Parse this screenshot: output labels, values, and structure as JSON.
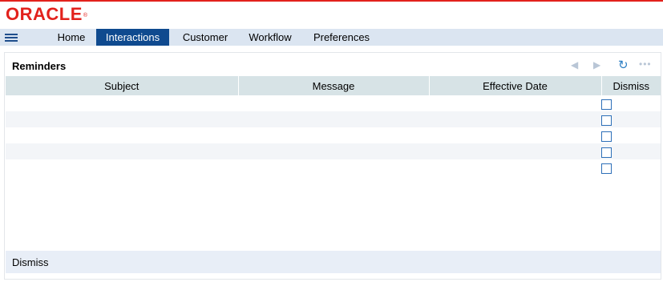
{
  "brand": {
    "logo_text": "ORACLE",
    "registered_mark": "®",
    "accent_color": "#e2211c"
  },
  "nav": {
    "menu_icon": "hamburger-menu-icon",
    "items": [
      {
        "label": "Home",
        "active": false
      },
      {
        "label": "Interactions",
        "active": true
      },
      {
        "label": "Customer",
        "active": false
      },
      {
        "label": "Workflow",
        "active": false
      },
      {
        "label": "Preferences",
        "active": false
      }
    ]
  },
  "reminders": {
    "title": "Reminders",
    "toolbar": {
      "prev_icon": "triangle-left-icon",
      "next_icon": "triangle-right-icon",
      "refresh_icon": "refresh-icon",
      "more_icon": "ellipsis-icon"
    },
    "columns": [
      "Subject",
      "Message",
      "Effective Date",
      "Dismiss"
    ],
    "rows": [
      {
        "subject": "",
        "message": "",
        "effective_date": "",
        "dismiss": false
      },
      {
        "subject": "",
        "message": "",
        "effective_date": "",
        "dismiss": false
      },
      {
        "subject": "",
        "message": "",
        "effective_date": "",
        "dismiss": false
      },
      {
        "subject": "",
        "message": "",
        "effective_date": "",
        "dismiss": false
      },
      {
        "subject": "",
        "message": "",
        "effective_date": "",
        "dismiss": false
      }
    ],
    "footer_action": "Dismiss"
  }
}
